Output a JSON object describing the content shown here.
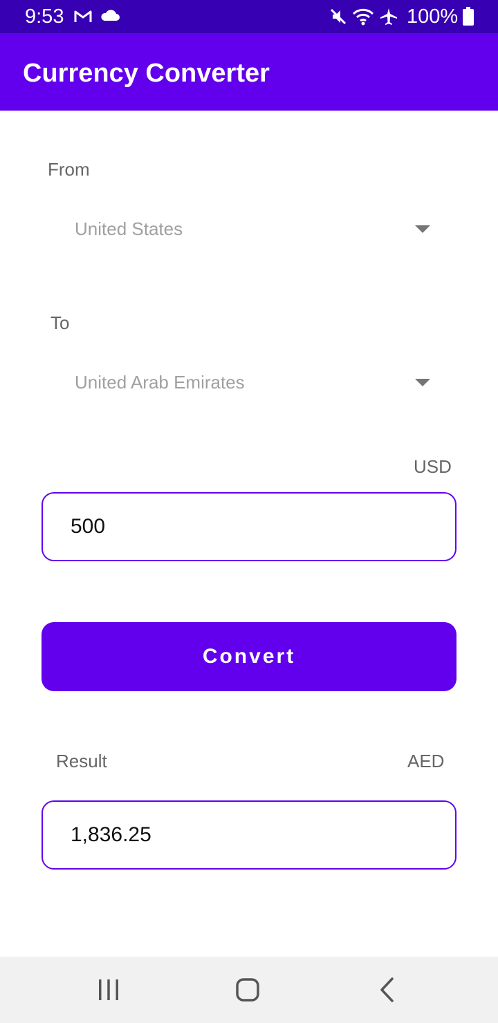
{
  "status_bar": {
    "time": "9:53",
    "battery": "100%",
    "icons": [
      "gmail-icon",
      "cloud-icon",
      "mute-icon",
      "wifi-icon",
      "airplane-mode-icon",
      "battery-icon"
    ]
  },
  "app_bar": {
    "title": "Currency Converter"
  },
  "form": {
    "from_label": "From",
    "from_value": "United States",
    "to_label": "To",
    "to_value": "United Arab Emirates",
    "amount_currency": "USD",
    "amount_value": "500",
    "convert_label": "Convert",
    "result_label": "Result",
    "result_currency": "AED",
    "result_value": "1,836.25"
  },
  "nav_bar": {
    "icons": [
      "recent-apps-icon",
      "home-icon",
      "back-icon"
    ]
  },
  "colors": {
    "primary": "#6200ee",
    "primary_dark": "#3700b3",
    "nav_background": "#f1f1f1"
  }
}
